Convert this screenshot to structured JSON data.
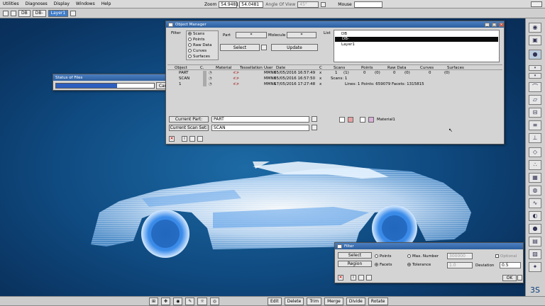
{
  "menubar": {
    "items": [
      "Utilities",
      "Diagnoses",
      "Display",
      "Windows",
      "Help"
    ]
  },
  "toolbar2": {
    "items": [
      "DB",
      "DB-",
      "Layer1"
    ]
  },
  "view_controls": {
    "zoom_label": "Zoom",
    "zoom_value": "54.9481",
    "zoom_value2": "54.0481",
    "angle_label": "Angle Of View",
    "angle_value": "45°",
    "mouse_label": "Mouse"
  },
  "status_window": {
    "title": "Status of Files",
    "progress": 0.62,
    "cancel_label": "Cancel"
  },
  "object_manager": {
    "title": "Object Manager",
    "filter_label": "Filter",
    "filter_options": [
      "Scans",
      "Points",
      "Raw Data",
      "Curves",
      "Surfaces"
    ],
    "part_label": "Part",
    "part_value": "*",
    "molecule_label": "Molecule",
    "molecule_value": "*",
    "select_label": "Select",
    "update_label": "Update",
    "list_label": "List",
    "list_items": [
      "DB",
      "DB-",
      "Layer1"
    ],
    "columns": [
      "Object",
      "C.",
      "Material",
      "Tessellation",
      "User",
      "Date",
      "C",
      "Scans",
      "Points",
      "Raw Data",
      "Curves",
      "Surfaces"
    ],
    "rows": [
      {
        "object": "PART",
        "user": "MMN6",
        "date": "05/05/2016 16:57:49",
        "c": "x",
        "scans": "1",
        "points": "(1)",
        "raw": "0",
        "raw2": "(0)",
        "curves": "0",
        "curves2": "(0)",
        "surfaces": "0",
        "surfaces2": "(0)"
      },
      {
        "object": "SCAN",
        "user": "MMN6",
        "date": "05/05/2016 16:57:50",
        "c": "x",
        "stats": "Scans: 1"
      },
      {
        "object": "1",
        "user": "MMN6",
        "date": "17/05/2016 17:27:48",
        "c": "x",
        "stats": "Lines: 1  Points: 659079  Facets: 1315815"
      }
    ],
    "current_part_label": "Current Part:",
    "current_part_value": "PART",
    "current_scan_label": "Current Scan Set:",
    "current_scan_value": "SCAN",
    "material_label": "Material1"
  },
  "filter_window": {
    "title": "Filter",
    "select_label": "Select",
    "region_label": "Region",
    "points_label": "Points",
    "facets_label": "Facets",
    "max_number_label": "Max. Number",
    "max_number_value": "300000",
    "tolerance_label": "Tolerance",
    "tolerance_value": "1.0",
    "optional_label": "Optional",
    "deviation_label": "Deviation",
    "deviation_value": "0.5",
    "ok_label": "OK"
  },
  "bottom_toolbar": {
    "items": [
      "Edit",
      "Delete",
      "Trim",
      "Merge",
      "Divide",
      "Rotate"
    ]
  },
  "colors": {
    "accent": "#3e7cc9",
    "background": "#0f4a80",
    "mesh": "#e6f3ff"
  }
}
